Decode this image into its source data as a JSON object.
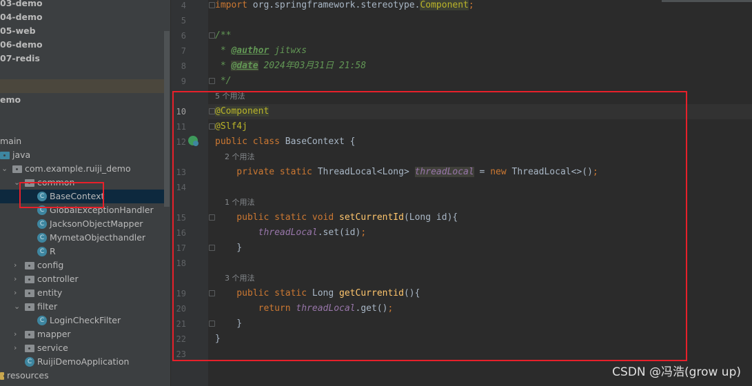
{
  "sidebar": {
    "items": [
      {
        "label": "03-demo",
        "style": "bold",
        "indent": 0
      },
      {
        "label": "04-demo",
        "style": "bold",
        "indent": 0
      },
      {
        "label": "05-web",
        "style": "bold",
        "indent": 0
      },
      {
        "label": "06-demo",
        "style": "bold",
        "indent": 0
      },
      {
        "label": "07-redis",
        "style": "bold",
        "indent": 0
      },
      {
        "label": "",
        "indent": 0
      },
      {
        "label": "",
        "style": "hl",
        "indent": 0
      },
      {
        "label": "emo",
        "style": "bold",
        "indent": 0
      },
      {
        "label": "",
        "indent": 0
      },
      {
        "label": "",
        "indent": 0
      },
      {
        "label": "main",
        "indent": 0,
        "chev": false
      },
      {
        "label": "java",
        "indent": 0,
        "icon": "source-folder-icon"
      },
      {
        "label": "com.example.ruiji_demo",
        "indent": 1,
        "icon": "package-icon",
        "chev": "down"
      },
      {
        "label": "common",
        "indent": 2,
        "icon": "package-icon",
        "chev": "down"
      },
      {
        "label": "BaseContext",
        "indent": 3,
        "icon": "class-icon",
        "style": "sel"
      },
      {
        "label": "GlobalExceptionHandler",
        "indent": 3,
        "icon": "class-icon"
      },
      {
        "label": "JacksonObjectMapper",
        "indent": 3,
        "icon": "class-icon"
      },
      {
        "label": "MymetaObjecthandler",
        "indent": 3,
        "icon": "class-icon"
      },
      {
        "label": "R",
        "indent": 3,
        "icon": "class-icon"
      },
      {
        "label": "config",
        "indent": 2,
        "icon": "package-icon",
        "chev": "right"
      },
      {
        "label": "controller",
        "indent": 2,
        "icon": "package-icon",
        "chev": "right"
      },
      {
        "label": "entity",
        "indent": 2,
        "icon": "package-icon",
        "chev": "right"
      },
      {
        "label": "filter",
        "indent": 2,
        "icon": "package-icon",
        "chev": "down"
      },
      {
        "label": "LoginCheckFilter",
        "indent": 3,
        "icon": "class-icon"
      },
      {
        "label": "mapper",
        "indent": 2,
        "icon": "package-icon",
        "chev": "right"
      },
      {
        "label": "service",
        "indent": 2,
        "icon": "package-icon",
        "chev": "right"
      },
      {
        "label": "RuijiDemoApplication",
        "indent": 2,
        "icon": "spring-boot-app-icon"
      },
      {
        "label": "resources",
        "indent": 0,
        "icon": "resources-folder-icon"
      }
    ]
  },
  "editor": {
    "rows": [
      {
        "ln": "4",
        "fold": true,
        "tokens": [
          [
            "import ",
            "kw"
          ],
          [
            "org.springframework.stereotype.",
            "plain"
          ],
          [
            "Component",
            "ann hlbg"
          ],
          [
            ";",
            "kw"
          ]
        ]
      },
      {
        "ln": "5",
        "tokens": []
      },
      {
        "ln": "6",
        "fold": true,
        "tokens": [
          [
            "/**",
            "doc"
          ]
        ]
      },
      {
        "ln": "7",
        "tokens": [
          [
            " * ",
            "doc"
          ],
          [
            "@author",
            "dtag"
          ],
          [
            " jitwxs",
            "doc"
          ]
        ]
      },
      {
        "ln": "8",
        "tokens": [
          [
            " * ",
            "doc"
          ],
          [
            "@date",
            "dtag hlbg"
          ],
          [
            " 2024年03月31日 21:58",
            "doc"
          ]
        ]
      },
      {
        "ln": "9",
        "fold": true,
        "tokens": [
          [
            " */",
            "doc"
          ]
        ]
      },
      {
        "hint": "5 个用法"
      },
      {
        "ln": "10",
        "cur": true,
        "fold": true,
        "tokens": [
          [
            "@Component",
            "ann hlbg"
          ]
        ]
      },
      {
        "ln": "11",
        "fold": true,
        "tokens": [
          [
            "@Slf4j",
            "ann"
          ]
        ]
      },
      {
        "ln": "12",
        "tokens": [
          [
            "public ",
            "kw"
          ],
          [
            "class ",
            "kw"
          ],
          [
            "BaseContext {",
            "plain"
          ]
        ]
      },
      {
        "hint": "    2 个用法"
      },
      {
        "ln": "13",
        "tokens": [
          [
            "    private ",
            "kw"
          ],
          [
            "static ",
            "kw"
          ],
          [
            "ThreadLocal<Long> ",
            "plain"
          ],
          [
            "threadLocal",
            "fld fldbg"
          ],
          [
            " = ",
            "plain"
          ],
          [
            "new ",
            "kw"
          ],
          [
            "ThreadLocal<>()",
            "plain"
          ],
          [
            ";",
            "kw"
          ]
        ]
      },
      {
        "ln": "14",
        "tokens": []
      },
      {
        "hint": "    1 个用法"
      },
      {
        "ln": "15",
        "fold": true,
        "tokens": [
          [
            "    public ",
            "kw"
          ],
          [
            "static ",
            "kw"
          ],
          [
            "void ",
            "kw"
          ],
          [
            "setCurrentId",
            "fn"
          ],
          [
            "(Long id){",
            "plain"
          ]
        ]
      },
      {
        "ln": "16",
        "tokens": [
          [
            "        ",
            "plain"
          ],
          [
            "threadLocal",
            "fld"
          ],
          [
            ".set(id)",
            "plain"
          ],
          [
            ";",
            "kw"
          ]
        ]
      },
      {
        "ln": "17",
        "fold": true,
        "tokens": [
          [
            "    }",
            "plain"
          ]
        ]
      },
      {
        "ln": "18",
        "tokens": []
      },
      {
        "hint": "    3 个用法"
      },
      {
        "ln": "19",
        "fold": true,
        "tokens": [
          [
            "    public ",
            "kw"
          ],
          [
            "static ",
            "kw"
          ],
          [
            "Long ",
            "plain"
          ],
          [
            "getCurrentid",
            "fn"
          ],
          [
            "(){",
            "plain"
          ]
        ]
      },
      {
        "ln": "20",
        "tokens": [
          [
            "        return ",
            "kw"
          ],
          [
            "threadLocal",
            "fld"
          ],
          [
            ".get()",
            "plain"
          ],
          [
            ";",
            "kw"
          ]
        ]
      },
      {
        "ln": "21",
        "fold": true,
        "tokens": [
          [
            "    }",
            "plain"
          ]
        ]
      },
      {
        "ln": "22",
        "tokens": [
          [
            "}",
            "plain"
          ]
        ]
      },
      {
        "ln": "23",
        "tokens": []
      }
    ]
  },
  "watermark": "CSDN @冯浩(grow up)",
  "colors": {
    "highlight_box": "#e8202a",
    "editor_bg": "#2b2b2b",
    "sidebar_bg": "#3c3f41",
    "selection": "#0d293e"
  }
}
